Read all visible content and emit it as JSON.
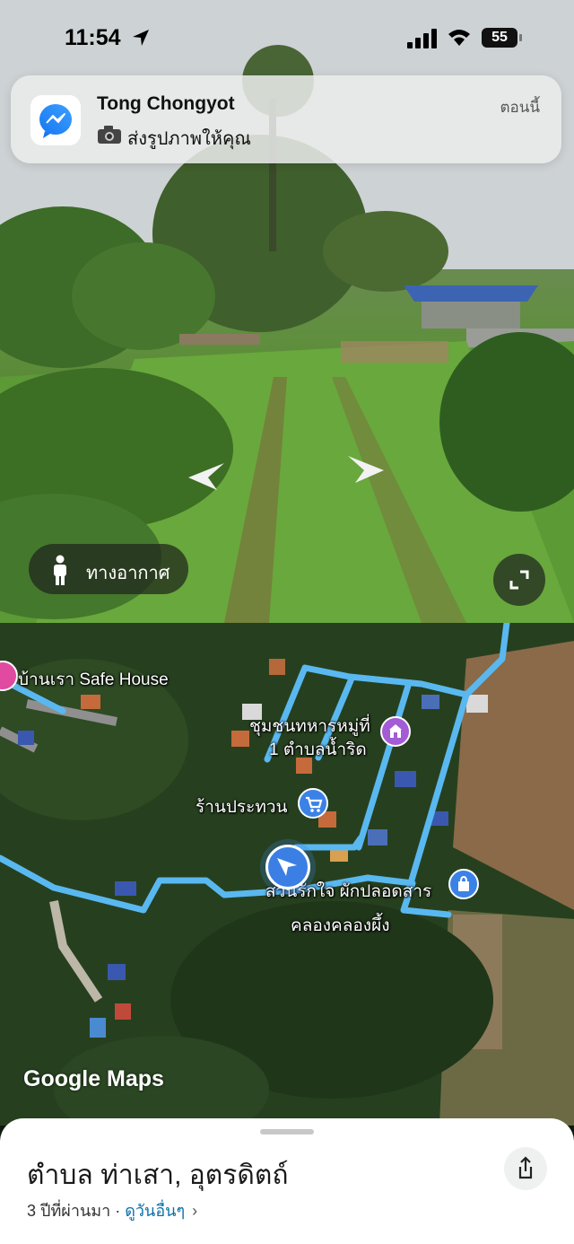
{
  "status_bar": {
    "time": "11:54",
    "battery": "55"
  },
  "notification": {
    "app_icon": "messenger-icon",
    "sender": "Tong Chongyot",
    "message": "ส่งรูปภาพให้คุณ",
    "timestamp": "ตอนนี้"
  },
  "street_view": {
    "aerial_button_label": "ทางอากาศ",
    "icons": [
      "person-icon",
      "expand-icon",
      "arrow-left-icon",
      "arrow-right-icon"
    ]
  },
  "map": {
    "labels": {
      "safe_house": "บ้านเรา Safe House",
      "community_line1": "ชุมชนทหารหมู่ที่",
      "community_line2": "1 ตำบลน้ำริด",
      "shop": "ร้านประทวน",
      "veg_shop": "สวนรักใจ ผักปลอดสาร",
      "canal": "คลองคลองผึ้ง"
    },
    "attribution": "Google Maps",
    "route_color": "#5ab8f0"
  },
  "bottom_sheet": {
    "place_title": "ตำบล ท่าเสา, อุตรดิตถ์",
    "age_text": "3 ปีที่ผ่านมา · ",
    "more_dates_link": "ดูวันอื่นๆ",
    "chevron": "›"
  }
}
